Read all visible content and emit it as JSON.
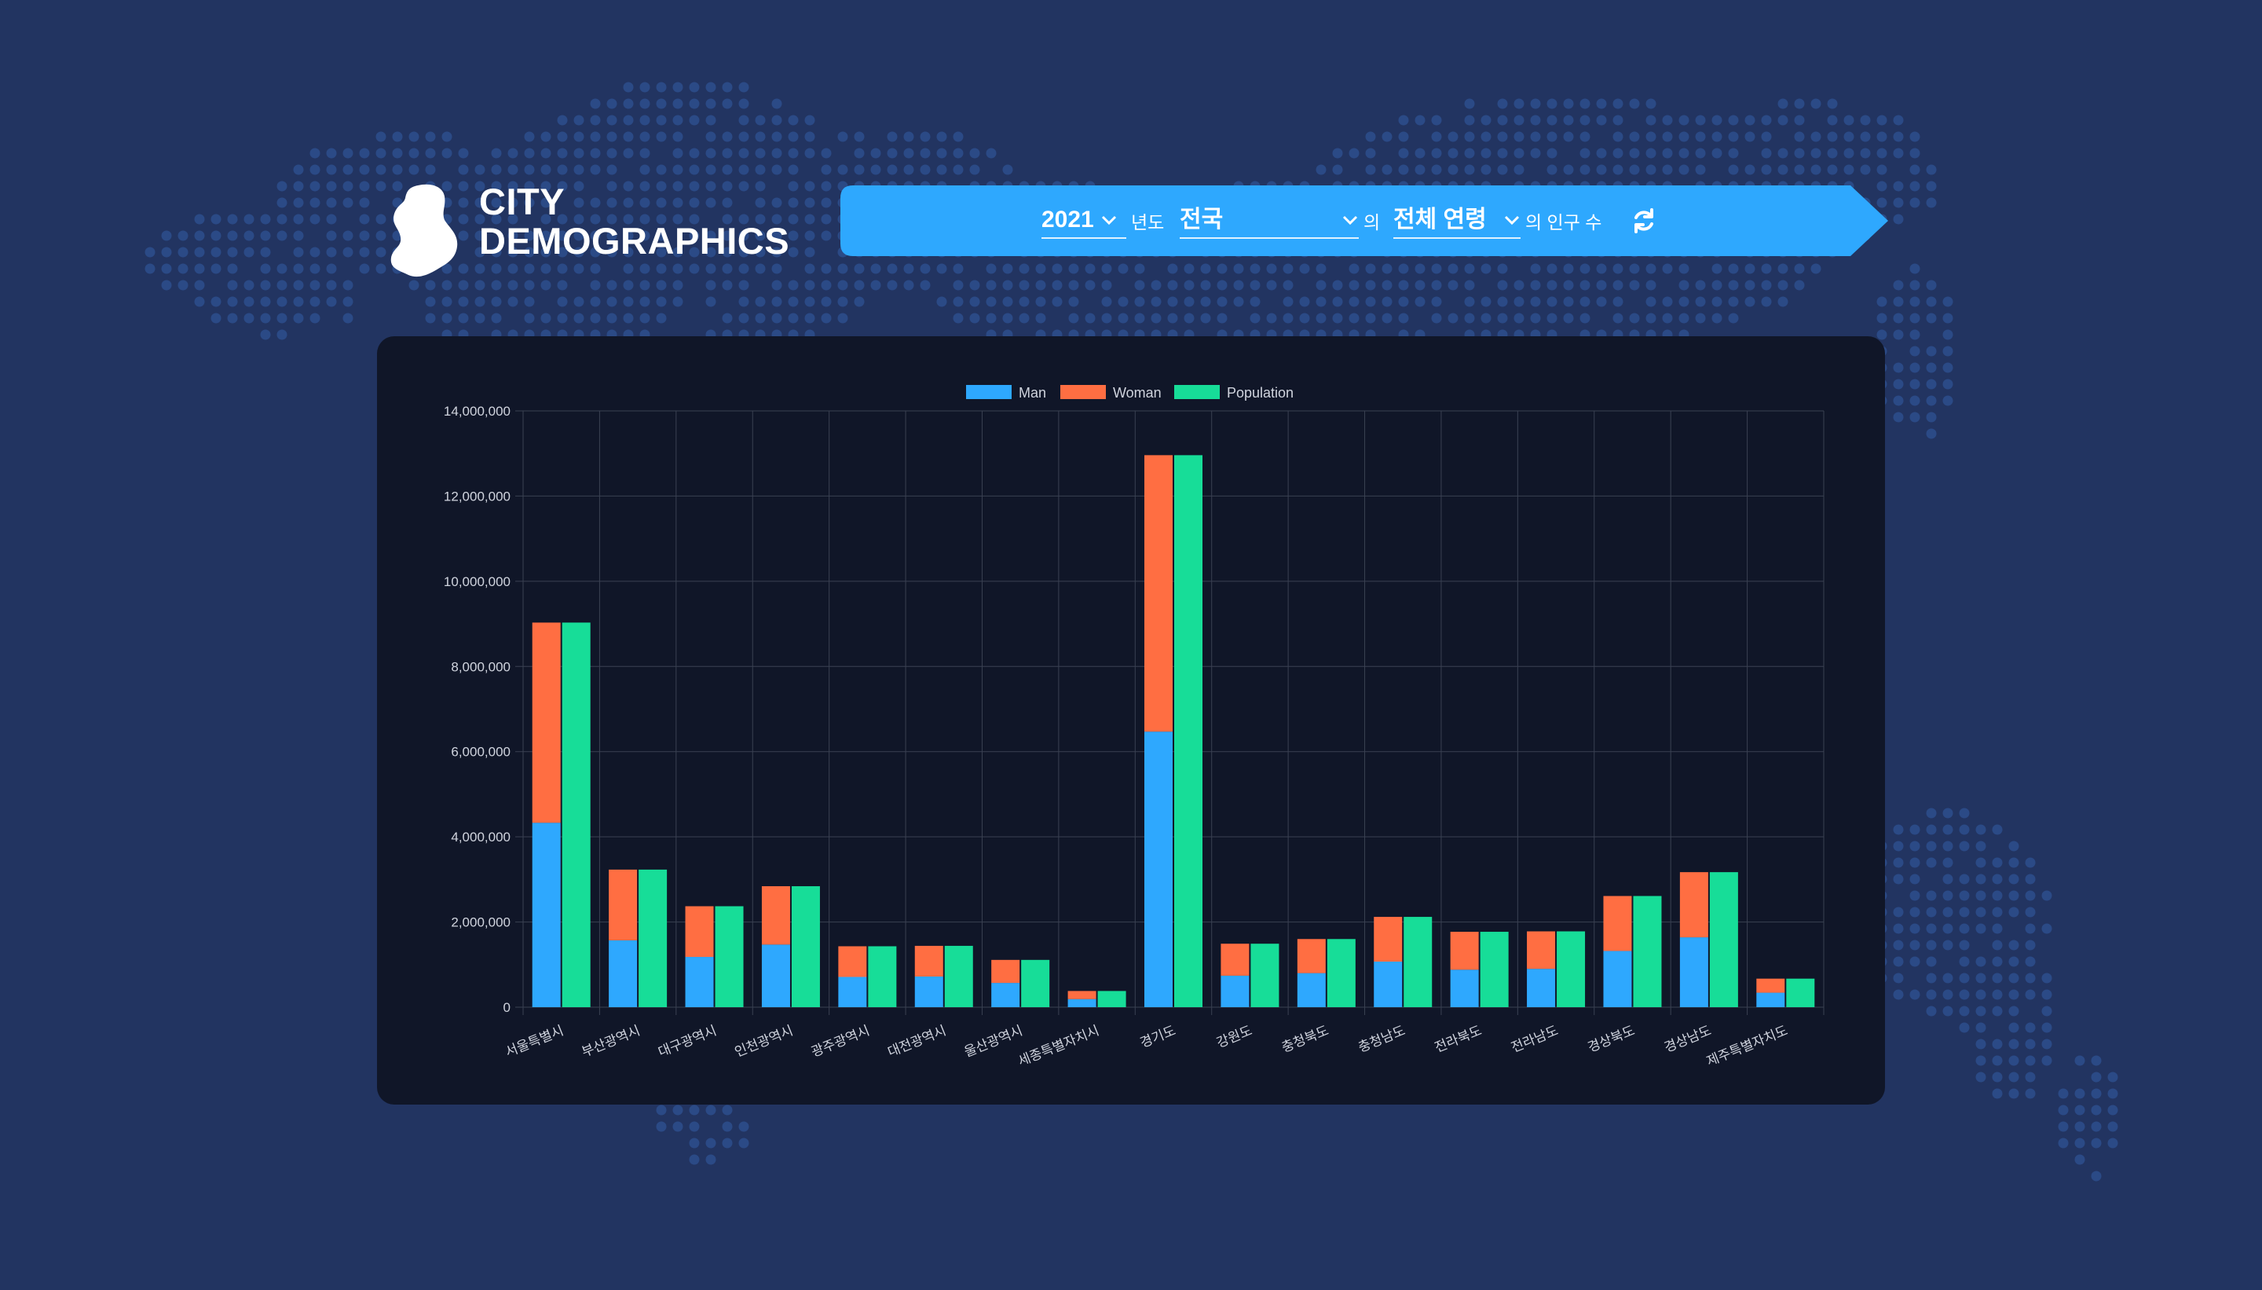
{
  "brand": {
    "line1": "CITY",
    "line2": "DEMOGRAPHICS"
  },
  "filters": {
    "year": "2021",
    "year_suffix": "년도",
    "region": "전국",
    "region_suffix": "의",
    "age": "전체 연령",
    "age_suffix": "의 인구 수",
    "refresh_icon": "refresh-icon"
  },
  "colors": {
    "background": "#223461",
    "panel": "#101628",
    "ribbon": "#2ea8fe",
    "man": "#2ea8fe",
    "woman": "#ff6e42",
    "population": "#17dd98"
  },
  "chart_data": {
    "type": "bar",
    "categories": [
      "서울특별시",
      "부산광역시",
      "대구광역시",
      "인천광역시",
      "광주광역시",
      "대전광역시",
      "울산광역시",
      "세종특별자치시",
      "경기도",
      "강원도",
      "충청북도",
      "충청남도",
      "전라북도",
      "전라남도",
      "경상북도",
      "경상남도",
      "제주특별자치도"
    ],
    "series": [
      {
        "name": "Man",
        "stack": "gender",
        "values": [
          4330000,
          1570000,
          1180000,
          1470000,
          710000,
          720000,
          570000,
          190000,
          6470000,
          740000,
          800000,
          1070000,
          880000,
          900000,
          1320000,
          1640000,
          340000
        ]
      },
      {
        "name": "Woman",
        "stack": "gender",
        "values": [
          4700000,
          1660000,
          1190000,
          1370000,
          720000,
          720000,
          540000,
          190000,
          6490000,
          750000,
          800000,
          1050000,
          890000,
          880000,
          1290000,
          1530000,
          330000
        ]
      },
      {
        "name": "Population",
        "stack": "total",
        "values": [
          9030000,
          3230000,
          2370000,
          2840000,
          1430000,
          1440000,
          1110000,
          380000,
          12960000,
          1490000,
          1600000,
          2120000,
          1770000,
          1780000,
          2610000,
          3170000,
          670000
        ]
      }
    ],
    "y_ticks": [
      "0",
      "2,000,000",
      "4,000,000",
      "6,000,000",
      "8,000,000",
      "10,000,000",
      "12,000,000",
      "14,000,000"
    ],
    "ylim": [
      0,
      14000000
    ],
    "stacked": true,
    "grid": true,
    "legend": "top-center"
  }
}
